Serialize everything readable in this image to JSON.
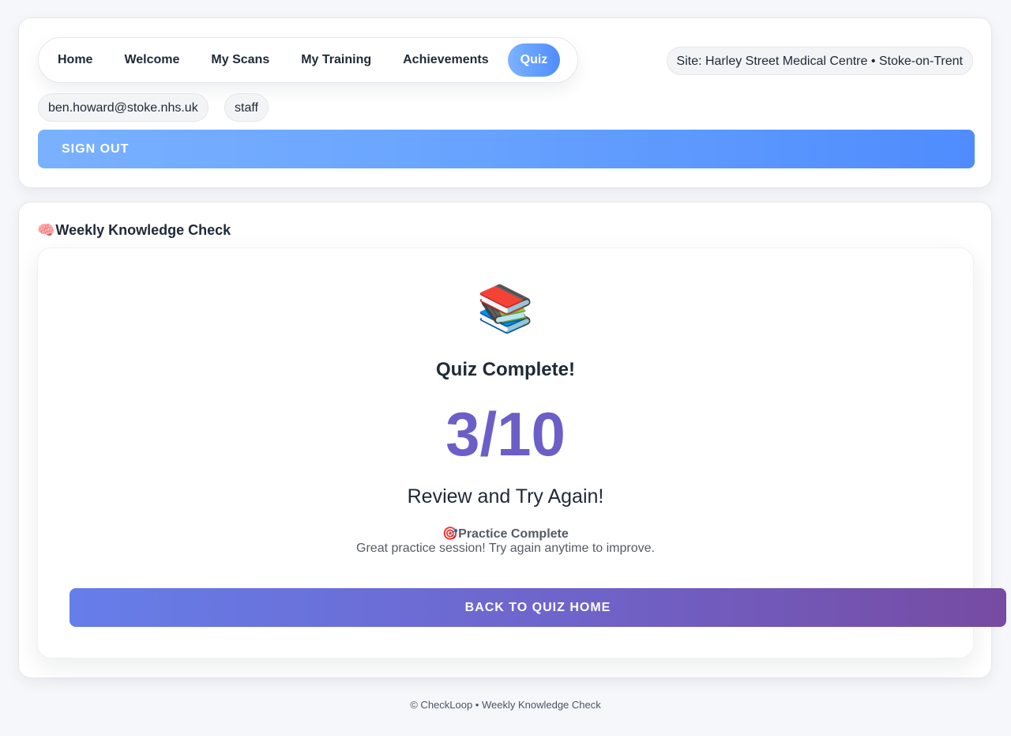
{
  "nav": {
    "items": [
      {
        "label": "Home"
      },
      {
        "label": "Welcome"
      },
      {
        "label": "My Scans"
      },
      {
        "label": "My Training"
      },
      {
        "label": "Achievements"
      },
      {
        "label": "Quiz",
        "active": true
      }
    ]
  },
  "site": {
    "label": "Site: Harley Street Medical Centre • Stoke-on-Trent"
  },
  "user": {
    "email": "ben.howard@stoke.nhs.uk",
    "role": "staff"
  },
  "signout": {
    "label": "SIGN OUT"
  },
  "section": {
    "icon": "🧠",
    "icon_name": "brain-icon",
    "title": "Weekly Knowledge Check"
  },
  "result": {
    "icon": "📚",
    "icon_name": "books-icon",
    "title": "Quiz Complete!",
    "score": "3/10",
    "verdict": "Review and Try Again!",
    "practice_icon": "🎯",
    "practice_icon_name": "target-icon",
    "practice_title": "Practice Complete",
    "practice_desc": "Great practice session! Try again anytime to improve.",
    "back_label": "BACK TO QUIZ HOME"
  },
  "footer": {
    "text": "© CheckLoop • Weekly Knowledge Check"
  },
  "colors": {
    "accent_blue": "#4f8dfd",
    "score_purple": "#6b5fc7",
    "button_gradient_start": "#667eea",
    "button_gradient_end": "#764ba2"
  }
}
